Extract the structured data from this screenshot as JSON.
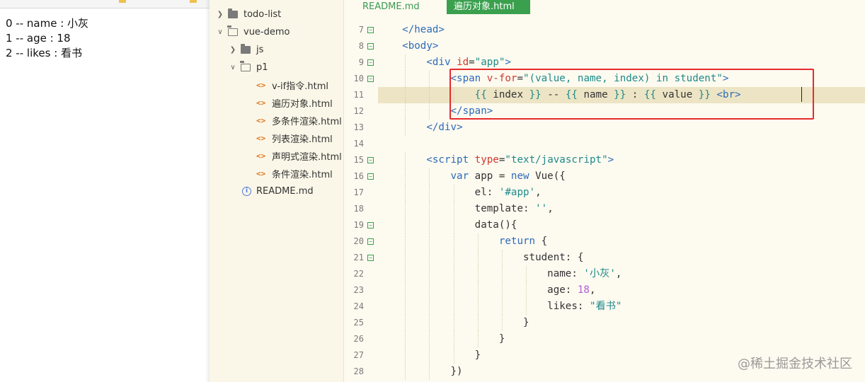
{
  "preview": {
    "lines": [
      "0 -- name : 小灰",
      "1 -- age : 18",
      "2 -- likes : 看书"
    ]
  },
  "tree": {
    "items": [
      {
        "label": "todo-list",
        "kind": "folder"
      },
      {
        "label": "vue-demo",
        "kind": "folder-open"
      },
      {
        "label": "js",
        "kind": "folder"
      },
      {
        "label": "p1",
        "kind": "folder-open"
      },
      {
        "label": "v-if指令.html",
        "kind": "html"
      },
      {
        "label": "遍历对象.html",
        "kind": "html"
      },
      {
        "label": "多条件渲染.html",
        "kind": "html"
      },
      {
        "label": "列表渲染.html",
        "kind": "html"
      },
      {
        "label": "声明式渲染.html",
        "kind": "html"
      },
      {
        "label": "条件渲染.html",
        "kind": "html"
      },
      {
        "label": "README.md",
        "kind": "info"
      }
    ],
    "icons": {
      "folder": "folder-icon",
      "html": "code-file-icon",
      "info": "info-icon"
    }
  },
  "tabs": [
    {
      "label": "README.md",
      "active": false
    },
    {
      "label": "遍历对象.html",
      "active": true
    }
  ],
  "editor": {
    "active_line": 11,
    "lines": [
      {
        "n": 7,
        "fold": true,
        "text": "    </head>"
      },
      {
        "n": 8,
        "fold": true,
        "text": "    <body>"
      },
      {
        "n": 9,
        "fold": true,
        "text": "        <div id=\"app\">"
      },
      {
        "n": 10,
        "fold": true,
        "text": "            <span v-for=\"(value, name, index) in student\">"
      },
      {
        "n": 11,
        "fold": false,
        "text": "                {{ index }} -- {{ name }} : {{ value }} <br>"
      },
      {
        "n": 12,
        "fold": false,
        "text": "            </span>"
      },
      {
        "n": 13,
        "fold": false,
        "text": "        </div>"
      },
      {
        "n": 14,
        "fold": false,
        "text": ""
      },
      {
        "n": 15,
        "fold": true,
        "text": "        <script type=\"text/javascript\">"
      },
      {
        "n": 16,
        "fold": true,
        "text": "            var app = new Vue({"
      },
      {
        "n": 17,
        "fold": false,
        "text": "                el: '#app',"
      },
      {
        "n": 18,
        "fold": false,
        "text": "                template: '',"
      },
      {
        "n": 19,
        "fold": true,
        "text": "                data(){"
      },
      {
        "n": 20,
        "fold": true,
        "text": "                    return {"
      },
      {
        "n": 21,
        "fold": true,
        "text": "                        student: {"
      },
      {
        "n": 22,
        "fold": false,
        "text": "                            name: '小灰',"
      },
      {
        "n": 23,
        "fold": false,
        "text": "                            age: 18,"
      },
      {
        "n": 24,
        "fold": false,
        "text": "                            likes: \"看书\""
      },
      {
        "n": 25,
        "fold": false,
        "text": "                        }"
      },
      {
        "n": 26,
        "fold": false,
        "text": "                    }"
      },
      {
        "n": 27,
        "fold": false,
        "text": "                }"
      },
      {
        "n": 28,
        "fold": false,
        "text": "            })"
      }
    ]
  },
  "colors": {
    "highlight_border": "#e62b2b",
    "active_tab": "#3aa04e",
    "tag": "#2e6bb8",
    "attr": "#d2392e",
    "string": "#1e8a8a",
    "number": "#b25fd0"
  },
  "watermark": "@稀土掘金技术社区"
}
